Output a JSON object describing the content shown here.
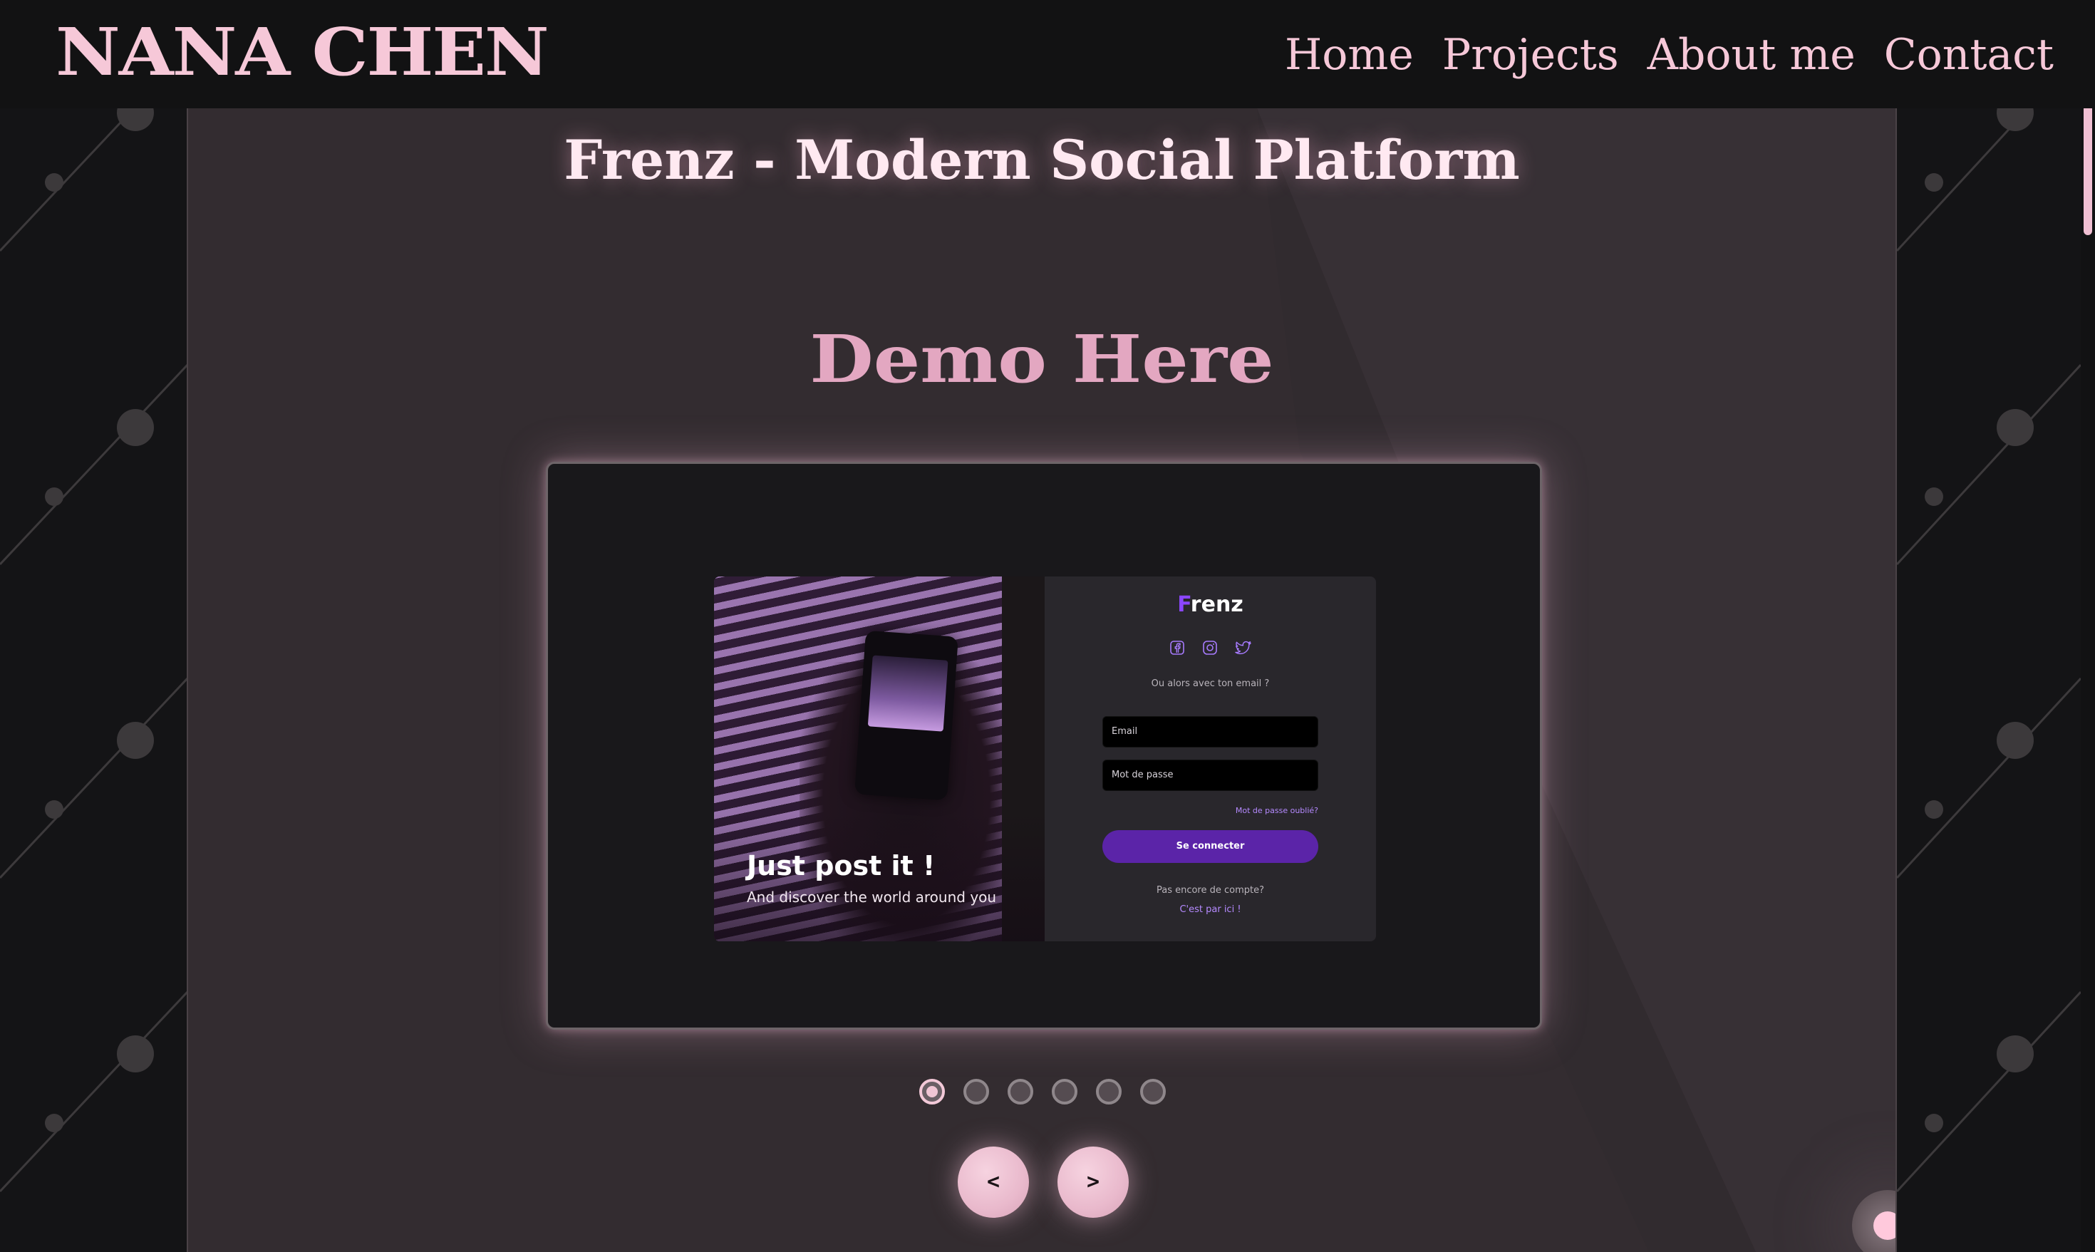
{
  "header": {
    "logo": "NANA CHEN",
    "nav": [
      "Home",
      "Projects",
      "About me",
      "Contact"
    ]
  },
  "project": {
    "title": "Frenz - Modern Social Platform",
    "demo_heading": "Demo Here"
  },
  "demo": {
    "brand_first_letter": "F",
    "brand_rest": "renz",
    "social_icons": [
      "facebook-icon",
      "instagram-icon",
      "twitter-icon"
    ],
    "or_email": "Ou alors avec ton email ?",
    "email_placeholder": "Email",
    "password_placeholder": "Mot de passe",
    "forgot_password": "Mot de passe oublié?",
    "login_button": "Se connecter",
    "no_account": "Pas encore de compte?",
    "signup_link": "C'est par ici !",
    "hero_title": "Just post it !",
    "hero_subtitle": "And discover the world around you"
  },
  "carousel": {
    "slide_count": 6,
    "active_index": 0,
    "prev_label": "<",
    "next_label": ">"
  },
  "colors": {
    "accent_pink": "#f6c8d8",
    "panel_bg": "#332c30",
    "frenz_purple": "#5b24a8"
  }
}
